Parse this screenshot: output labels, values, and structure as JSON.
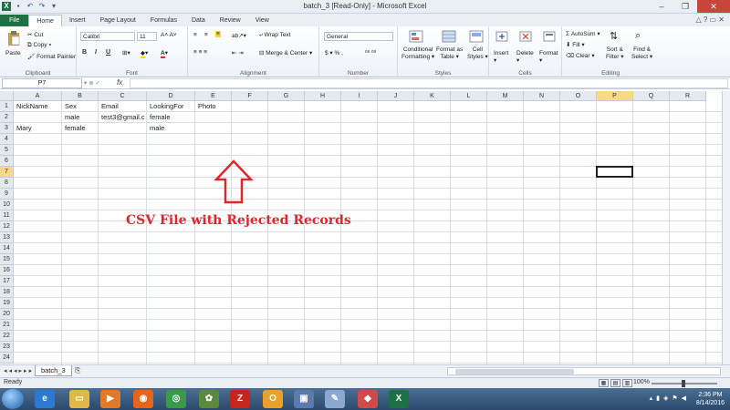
{
  "window": {
    "title": "batch_3  [Read-Only]  -  Microsoft Excel",
    "minimize_icon": "minimize-icon",
    "restore_icon": "restore-icon",
    "close_icon": "close-icon"
  },
  "tabs": [
    "File",
    "Home",
    "Insert",
    "Page Layout",
    "Formulas",
    "Data",
    "Review",
    "View"
  ],
  "ribbon": {
    "clipboard": {
      "paste": "Paste",
      "cut": "Cut",
      "copy": "Copy",
      "format_painter": "Format Painter",
      "label": "Clipboard"
    },
    "font": {
      "name": "Calibri",
      "size": "11",
      "label": "Font"
    },
    "alignment": {
      "wrap": "Wrap Text",
      "merge": "Merge & Center",
      "label": "Alignment"
    },
    "number": {
      "format": "General",
      "label": "Number"
    },
    "styles": {
      "conditional": "Conditional",
      "conditional2": "Formatting",
      "format_table": "Format as",
      "format_table2": "Table",
      "cell_styles": "Cell",
      "cell_styles2": "Styles",
      "label": "Styles"
    },
    "cells": {
      "insert": "Insert",
      "delete": "Delete",
      "format": "Format",
      "label": "Cells"
    },
    "editing": {
      "autosum": "AutoSum",
      "fill": "Fill",
      "clear": "Clear",
      "sort": "Sort &",
      "sort2": "Filter",
      "find": "Find &",
      "find2": "Select",
      "label": "Editing"
    }
  },
  "formula_bar": {
    "name_box": "P7",
    "fx": "fx",
    "value": ""
  },
  "columns": [
    "A",
    "B",
    "C",
    "D",
    "E",
    "F",
    "G",
    "H",
    "I",
    "J",
    "K",
    "L",
    "M",
    "N",
    "O",
    "P",
    "Q",
    "R"
  ],
  "rows": [
    "1",
    "2",
    "3",
    "4",
    "5",
    "6",
    "7",
    "8",
    "9",
    "10",
    "11",
    "12",
    "13",
    "14",
    "15",
    "16",
    "17",
    "18",
    "19",
    "20",
    "21",
    "22",
    "23",
    "24"
  ],
  "sheet_data": {
    "r1": {
      "A": "NickName",
      "B": "Sex",
      "C": "Email",
      "D": "LookingFor",
      "E": "Photo"
    },
    "r2": {
      "B": "male",
      "C": "test3@gmail.c",
      "D": "female"
    },
    "r3": {
      "A": "Mary",
      "B": "female",
      "D": "male"
    }
  },
  "annotation": "CSV File with Rejected Records",
  "sheet_tab": "batch_3",
  "status": {
    "ready": "Ready",
    "zoom": "100%"
  },
  "taskbar": {
    "time": "2:36 PM",
    "date": "8/14/2016"
  },
  "colors": {
    "excel_green": "#1e7145",
    "annotation_red": "#e0262b",
    "selection_header": "#f8d98a"
  }
}
